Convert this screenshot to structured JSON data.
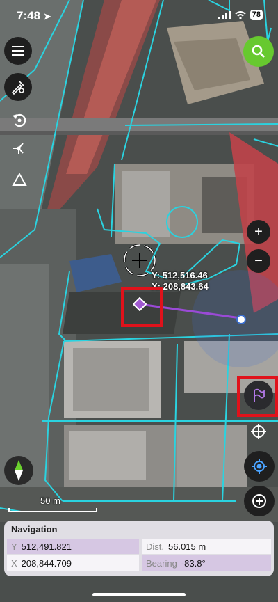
{
  "status_bar": {
    "time": "7:48",
    "battery": "78"
  },
  "map": {
    "coord_y": "Y: 512,516.46",
    "coord_x": "X: 208,843.64",
    "scale_label": "50 m"
  },
  "navigation": {
    "title": "Navigation",
    "y_label": "Y",
    "y_value": "512,491.821",
    "x_label": "X",
    "x_value": "208,844.709",
    "dist_label": "Dist.",
    "dist_value": "56.015 m",
    "bearing_label": "Bearing",
    "bearing_value": "-83.8°"
  },
  "colors": {
    "accent_green": "#67c92f",
    "highlight_red": "#e0121b",
    "parcel_cyan": "#2ad3e0",
    "nav_purple": "#d6c7e3"
  },
  "icons": [
    "location-arrow-icon",
    "signal-icon",
    "wifi-icon",
    "menu-icon",
    "search-icon",
    "draw-tools-icon",
    "undo-icon",
    "vertex-icon",
    "angle-measure-icon",
    "zoom-in-icon",
    "zoom-out-icon",
    "flag-icon",
    "crosshair-icon",
    "gps-locate-icon",
    "add-point-icon",
    "compass-icon"
  ]
}
